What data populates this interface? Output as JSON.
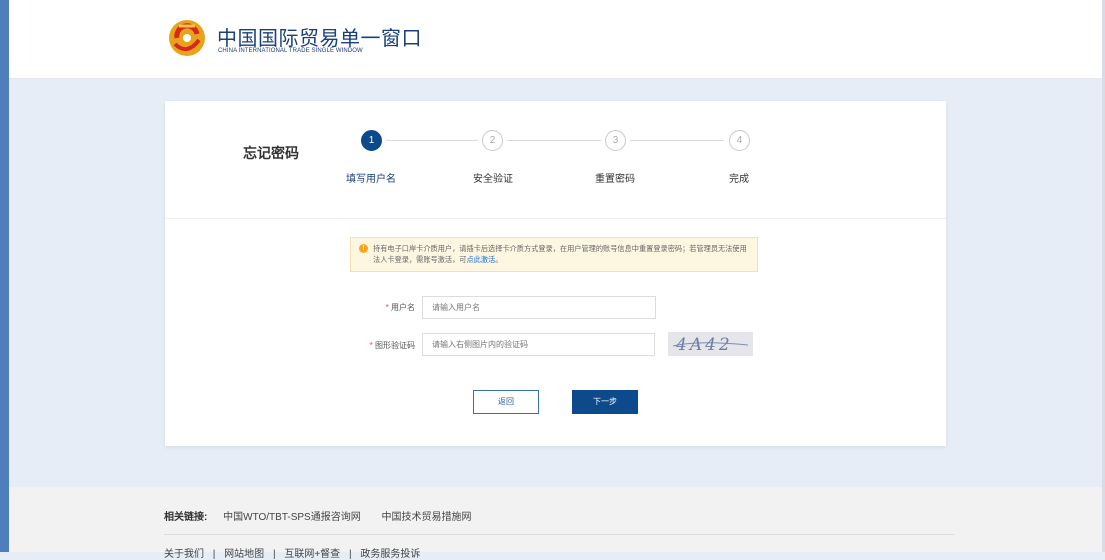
{
  "header": {
    "title": "中国国际贸易单一窗口",
    "subtitle": "CHINA INTERNATIONAL TRADE SINGLE WINDOW"
  },
  "page": {
    "title": "忘记密码",
    "steps": [
      {
        "number": "1",
        "label": "填写用户名",
        "active": true
      },
      {
        "number": "2",
        "label": "安全验证",
        "active": false
      },
      {
        "number": "3",
        "label": "重置密码",
        "active": false
      },
      {
        "number": "4",
        "label": "完成",
        "active": false
      }
    ],
    "notice": {
      "text": "持有电子口岸卡介质用户，请插卡后选择卡介质方式登录，在用户管理的账号信息中重置登录密码；若管理员无法使用法人卡登录，需账号激活，可",
      "link": "点此激活",
      "end": "。"
    }
  },
  "form": {
    "username": {
      "label": "用户名",
      "placeholder": "请输入用户名",
      "value": ""
    },
    "captcha": {
      "label": "图形验证码",
      "placeholder": "请输入右侧图片内的验证码",
      "value": "",
      "image_text": "4A42"
    },
    "required_mark": "*",
    "back_label": "返回",
    "next_label": "下一步"
  },
  "footer": {
    "links_title": "相关链接:",
    "links": [
      "中国WTO/TBT-SPS通报咨询网",
      "中国技术贸易措施网"
    ],
    "bottom_links": [
      "关于我们",
      "|",
      "网站地图",
      "|",
      "互联网+督查",
      "|",
      "政务服务投诉"
    ]
  },
  "colors": {
    "brand": "#0c4a8c",
    "background": "#e6edf6",
    "notice_bg": "#fdf6e1",
    "required": "#e5483b"
  }
}
